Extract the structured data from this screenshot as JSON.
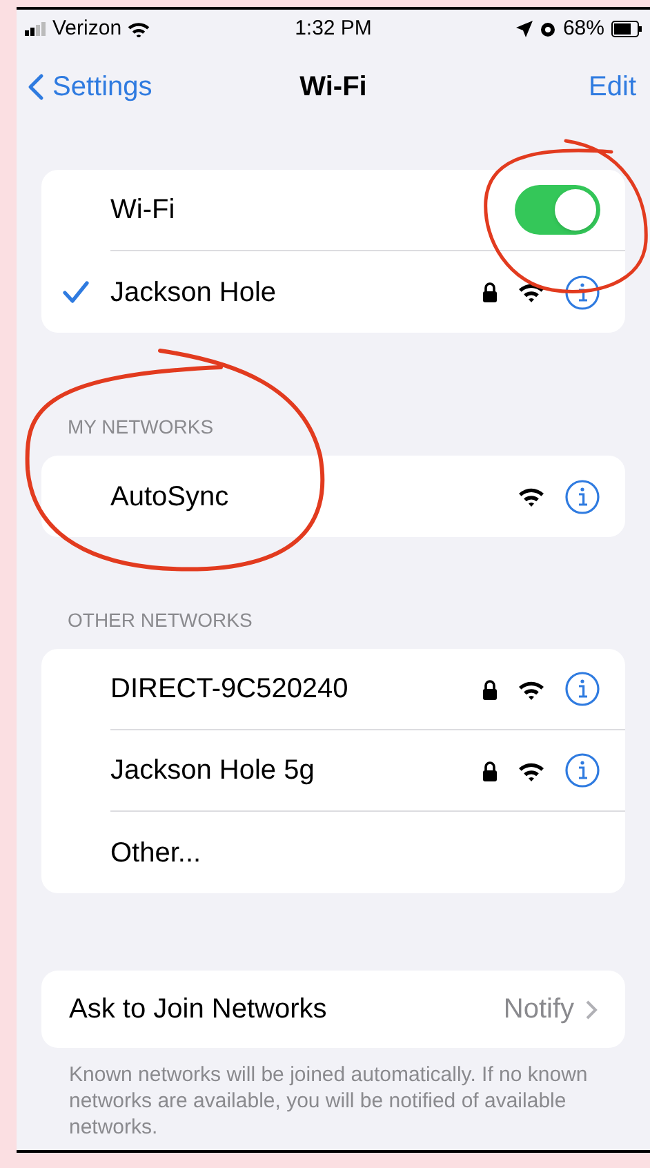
{
  "status_bar": {
    "carrier": "Verizon",
    "time": "1:32 PM",
    "battery": "68%"
  },
  "nav": {
    "back": "Settings",
    "title": "Wi-Fi",
    "action": "Edit"
  },
  "wifi": {
    "label": "Wi-Fi",
    "on": true
  },
  "current_network": {
    "name": "Jackson Hole",
    "selected": true,
    "locked": true
  },
  "my_networks": {
    "header": "MY NETWORKS",
    "items": [
      {
        "kind": "network",
        "name": "AutoSync",
        "locked": false
      }
    ]
  },
  "other_networks": {
    "header": "OTHER NETWORKS",
    "items": [
      {
        "kind": "network",
        "name": "DIRECT-9C520240",
        "locked": true
      },
      {
        "kind": "network",
        "name": "Jackson Hole 5g",
        "locked": true
      },
      {
        "kind": "other",
        "name": "Other..."
      }
    ]
  },
  "ask_to_join": {
    "label": "Ask to Join Networks",
    "value": "Notify"
  },
  "footer": "Known networks will be joined automatically. If no known networks are available, you will be notified of available networks."
}
